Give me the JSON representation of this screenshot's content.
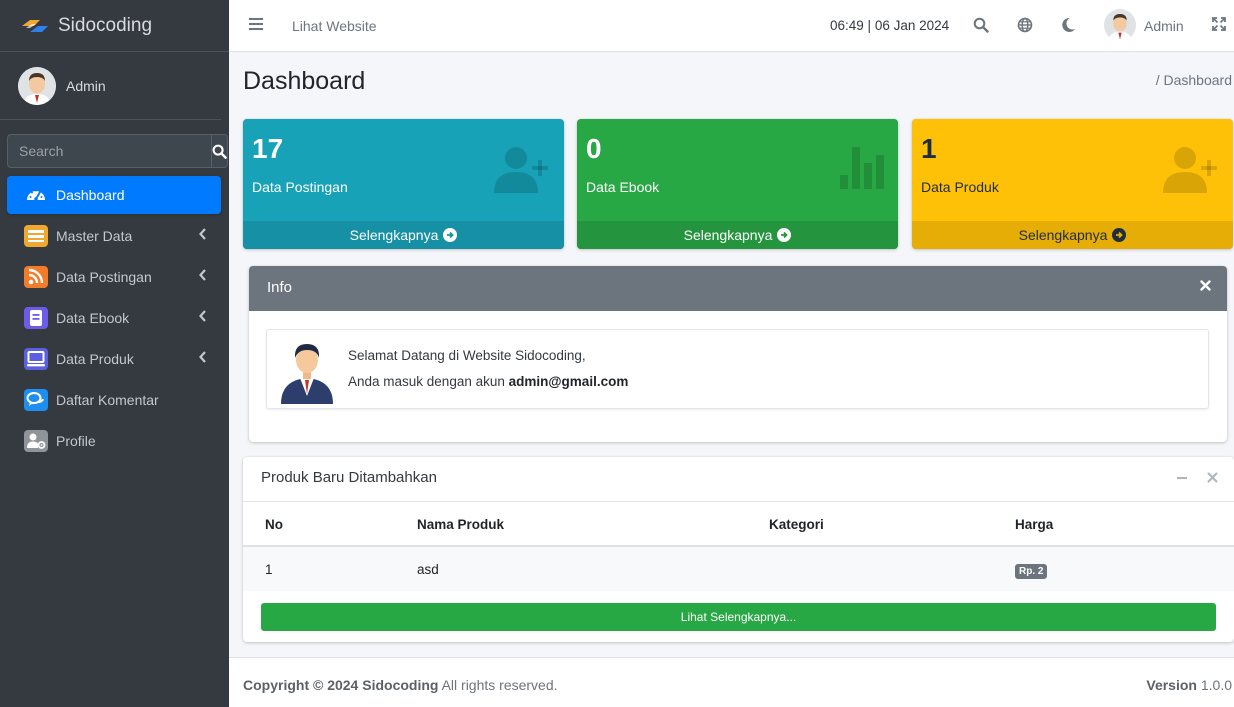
{
  "brand": {
    "name": "Sidocoding"
  },
  "sidebar": {
    "user_name": "Admin",
    "search_placeholder": "Search",
    "items": [
      {
        "label": "Dashboard",
        "icon": "speedometer-icon",
        "icon_bg": "",
        "active": true,
        "has_arrow": false
      },
      {
        "label": "Master Data",
        "icon": "list-icon",
        "icon_bg": "#f0a830",
        "active": false,
        "has_arrow": true
      },
      {
        "label": "Data Postingan",
        "icon": "rss-icon",
        "icon_bg": "#f37c2a",
        "active": false,
        "has_arrow": true
      },
      {
        "label": "Data Ebook",
        "icon": "book-icon",
        "icon_bg": "#6c5ce7",
        "active": false,
        "has_arrow": true
      },
      {
        "label": "Data Produk",
        "icon": "laptop-icon",
        "icon_bg": "#5b5fe0",
        "active": false,
        "has_arrow": true
      },
      {
        "label": "Daftar Komentar",
        "icon": "chat-icon",
        "icon_bg": "#1f8ef1",
        "active": false,
        "has_arrow": false
      },
      {
        "label": "Profile",
        "icon": "user-gear-icon",
        "icon_bg": "#8e9499",
        "active": false,
        "has_arrow": false
      }
    ]
  },
  "topbar": {
    "link": "Lihat Website",
    "time": "06:49",
    "date": "06 Jan 2024",
    "user": "Admin"
  },
  "page": {
    "title": "Dashboard",
    "breadcrumb": "/ Dashboard"
  },
  "stats": [
    {
      "count": "17",
      "label": "Data Postingan",
      "footer": "Selengkapnya",
      "color": "#17a2b8"
    },
    {
      "count": "0",
      "label": "Data Ebook",
      "footer": "Selengkapnya",
      "color": "#28a745"
    },
    {
      "count": "1",
      "label": "Data Produk",
      "footer": "Selengkapnya",
      "color": "#ffc107"
    }
  ],
  "info": {
    "title": "Info",
    "line1": "Selamat Datang di Website Sidocoding,",
    "line2_prefix": "Anda masuk dengan akun",
    "email": "admin@gmail.com"
  },
  "products": {
    "title": "Produk Baru Ditambahkan",
    "columns": [
      "No",
      "Nama Produk",
      "Kategori",
      "Harga"
    ],
    "rows": [
      {
        "no": "1",
        "name": "asd",
        "category": "",
        "price": "Rp. 2"
      }
    ],
    "more_button": "Lihat Selengkapnya..."
  },
  "footer": {
    "copyright": "Copyright © 2024 Sidocoding",
    "rights": "All rights reserved.",
    "version_label": "Version",
    "version": "1.0.0"
  }
}
